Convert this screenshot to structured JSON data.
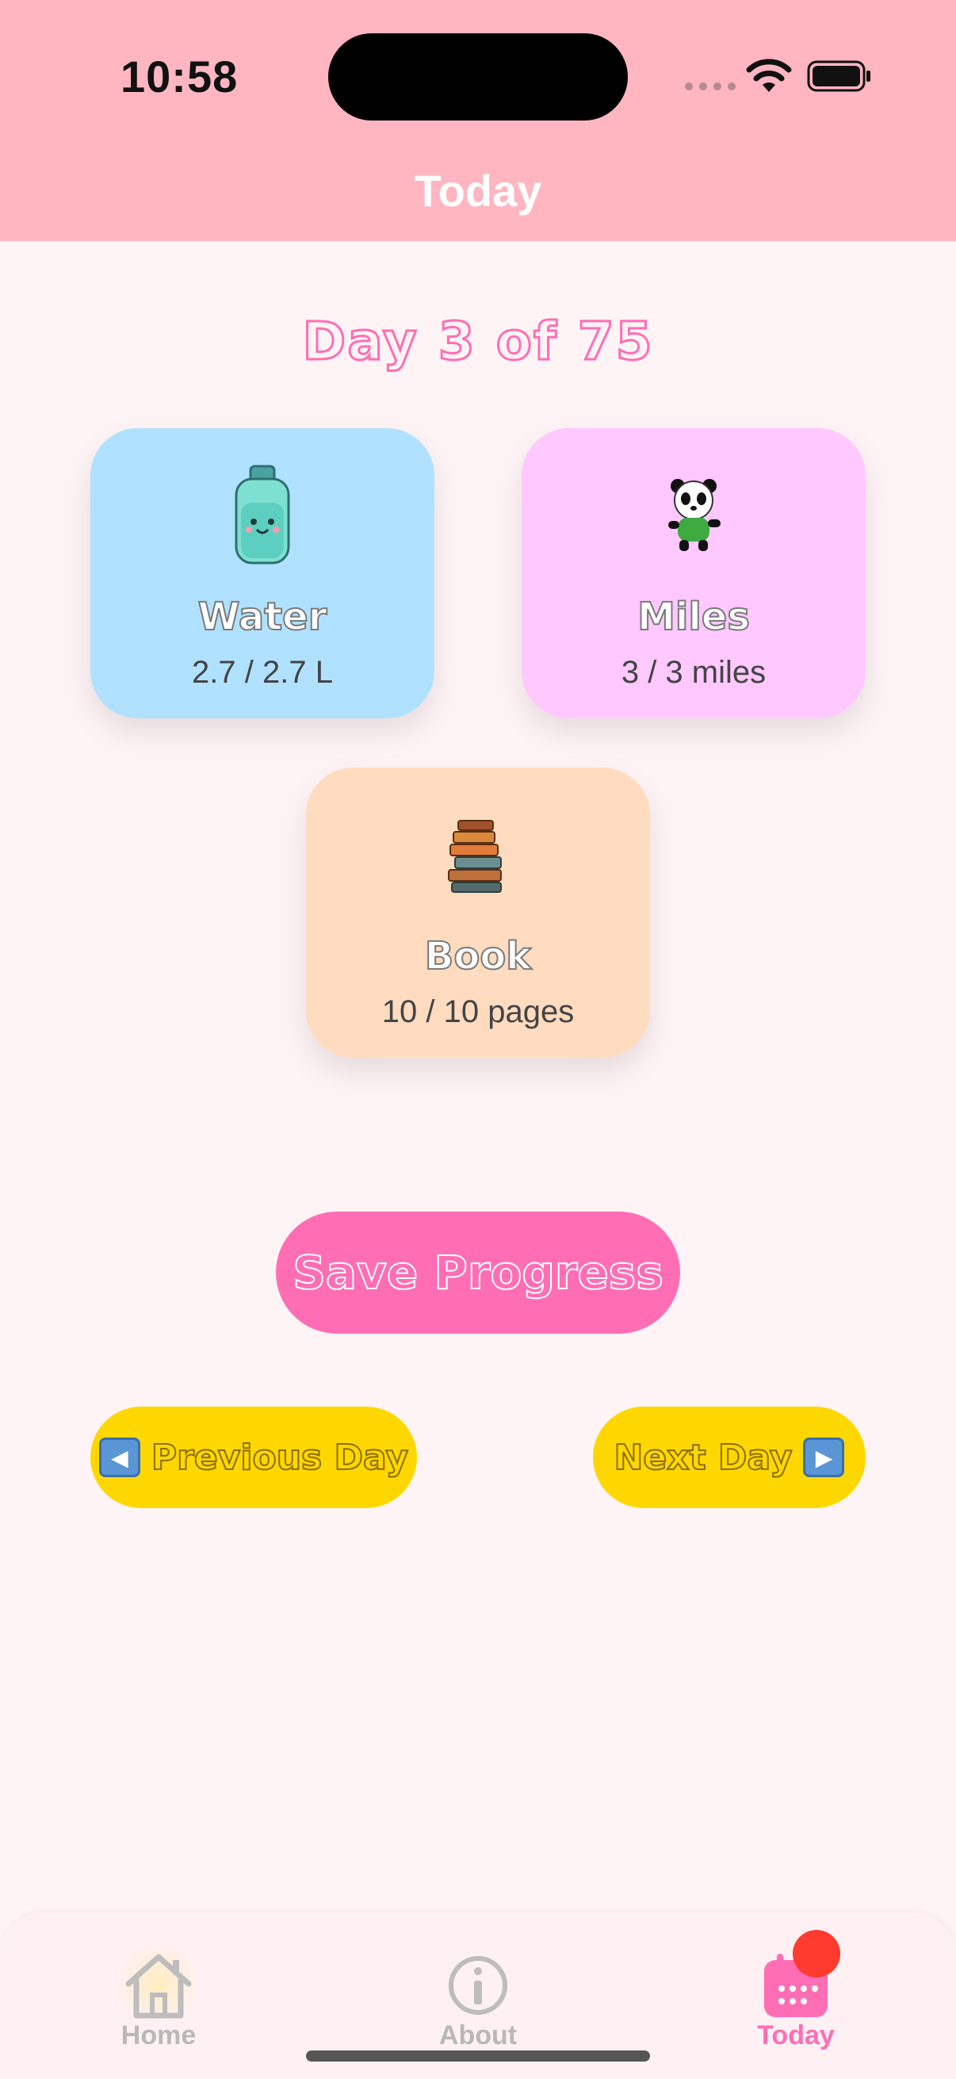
{
  "status_bar": {
    "time": "10:58"
  },
  "header": {
    "title": "Today"
  },
  "progress": {
    "day_title": "Day 3 of 75"
  },
  "cards": [
    {
      "label": "Water",
      "value": "2.7 / 2.7 L",
      "icon": "water-bottle-icon"
    },
    {
      "label": "Miles",
      "value": "3 / 3 miles",
      "icon": "panda-icon"
    },
    {
      "label": "Book",
      "value": "10 / 10 pages",
      "icon": "books-icon"
    }
  ],
  "actions": {
    "save_label": "Save Progress",
    "prev_label": "Previous Day",
    "next_label": "Next Day"
  },
  "tabbar": {
    "items": [
      {
        "label": "Home",
        "icon": "house-icon"
      },
      {
        "label": "About",
        "icon": "info-icon"
      },
      {
        "label": "Today",
        "icon": "calendar-icon"
      }
    ]
  },
  "colors": {
    "header": "#ffb6c1",
    "background": "#fff4f5",
    "accent_pink": "#ff6eb4",
    "water_card": "#b0e2ff",
    "miles_card": "#ffc8ff",
    "book_card": "#ffdbc0",
    "nav_yellow": "#ffd700",
    "badge_red": "#ff3b30"
  }
}
